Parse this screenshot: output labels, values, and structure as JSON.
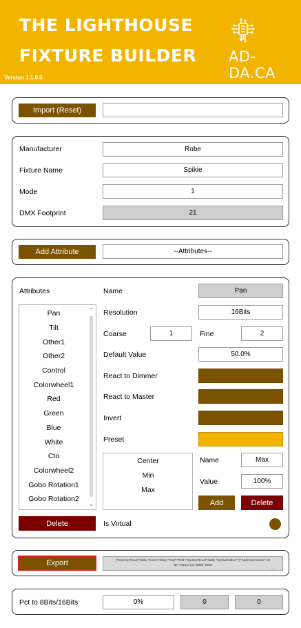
{
  "header": {
    "title_line1": "THE LIGHTHOUSE",
    "title_line2": "FIXTURE BUILDER",
    "brand": "AD-DA.CA",
    "logo_icon": "circuit-chip-icon",
    "version": "Version 1.1.0.0",
    "background_color": "#f3b400"
  },
  "import": {
    "button_label": "Import (Reset)",
    "input_value": ""
  },
  "fixture": {
    "manufacturer_label": "Manufacturer",
    "manufacturer_value": "Robe",
    "fixture_name_label": "Fixture Name",
    "fixture_name_value": "Spikie",
    "mode_label": "Mode",
    "mode_value": "1",
    "footprint_label": "DMX Footprint",
    "footprint_value": "21"
  },
  "attribute_add": {
    "button_label": "Add Attribute",
    "select_value": "--Attributes--"
  },
  "attributes": {
    "header_label": "Attributes",
    "items": [
      "Pan",
      "Tilt",
      "Other1",
      "Other2",
      "Control",
      "Colorwheel1",
      "Red",
      "Green",
      "Blue",
      "White",
      "Cto",
      "Colorwheel2",
      "Gobo Rotation1",
      "Gobo Rotation2"
    ],
    "delete_label": "Delete",
    "is_virtual_label": "Is Virtual"
  },
  "attribute_detail": {
    "name_label": "Name",
    "name_value": "Pan",
    "resolution_label": "Resolution",
    "resolution_value": "16Bits",
    "coarse_label": "Coarse",
    "coarse_value": "1",
    "fine_label": "Fine",
    "fine_value": "2",
    "default_value_label": "Default Value",
    "default_value_value": "50.0%",
    "react_dimmer_label": "React to Dimmer",
    "react_master_label": "React to Master",
    "invert_label": "Invert",
    "preset_label": "Preset",
    "toggle_on_color": "#7a5200",
    "preset_color": "#f3b400"
  },
  "presets": {
    "items": [
      "Center",
      "Min",
      "Max"
    ],
    "name_label": "Name",
    "name_value": "Max",
    "value_label": "Value",
    "value_value": "100%",
    "add_label": "Add",
    "delete_label": "Delete"
  },
  "export": {
    "button_label": "Export",
    "json_line1": "{\"DimmerReact\":false,\"Invert\":false,\"Text\":\"Red\",\"MasterReact\":false,\"DefaultValue\":\"{\"AddressCoarse\":16",
    "json_line2": "\"ID\":\"e8a1757c-88b8-4960-",
    "json_ellipsis": "...",
    "json_ellipsis_right": "..."
  },
  "pct": {
    "label": "Pct to 8Bits/16Bits",
    "percent_value": "0%",
    "bits8_value": "0",
    "bits16_value": "0"
  }
}
